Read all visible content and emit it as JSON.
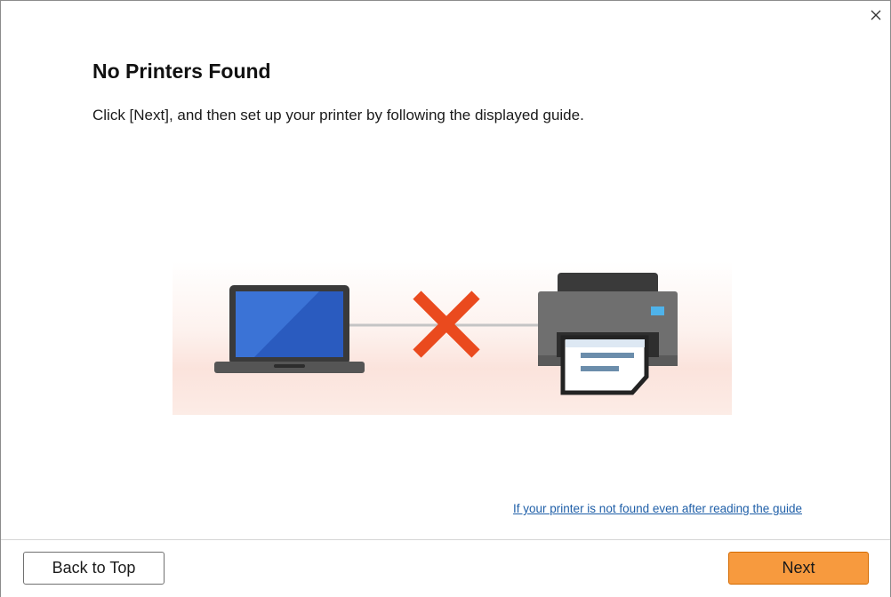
{
  "dialog": {
    "title": "No Printers Found",
    "instruction": "Click [Next], and then set up your printer by following the displayed guide.",
    "guide_link": "If your printer is not found even after reading the guide"
  },
  "illustration": {
    "left_device": "laptop-icon",
    "status_mark": "x-mark-icon",
    "right_device": "printer-icon",
    "colors": {
      "x_mark": "#ea4a1e",
      "laptop_screen": "#2a5bbf",
      "printer_body": "#6f6f6f",
      "printer_light": "#4fb3ea"
    }
  },
  "footer": {
    "back_label": "Back to Top",
    "next_label": "Next"
  },
  "colors": {
    "accent": "#f79a3e",
    "link": "#1f5fa8"
  }
}
